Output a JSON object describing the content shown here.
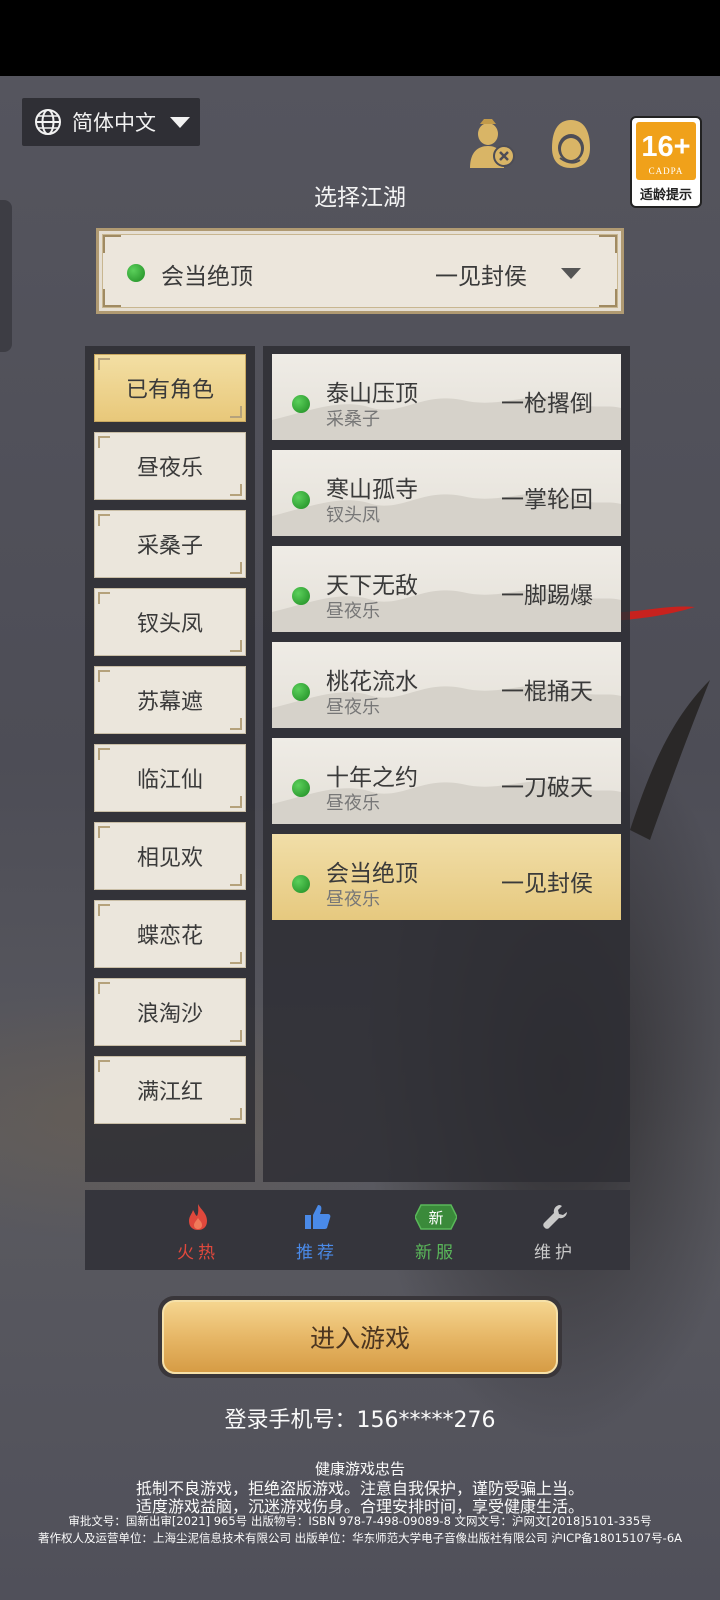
{
  "language": {
    "label": "简体中文"
  },
  "age_rating": {
    "badge": "16+",
    "org": "CADPA",
    "tip": "适龄提示"
  },
  "title": "选择江湖",
  "selected_server": {
    "name": "会当绝顶",
    "role": "一见封侯",
    "status_color": "#2e9e32"
  },
  "categories": [
    {
      "label": "已有角色",
      "active": true
    },
    {
      "label": "昼夜乐"
    },
    {
      "label": "采桑子"
    },
    {
      "label": "钗头凤"
    },
    {
      "label": "苏幕遮"
    },
    {
      "label": "临江仙"
    },
    {
      "label": "相见欢"
    },
    {
      "label": "蝶恋花"
    },
    {
      "label": "浪淘沙"
    },
    {
      "label": "满江红"
    }
  ],
  "servers": [
    {
      "name": "泰山压顶",
      "group": "采桑子",
      "role": "一枪撂倒"
    },
    {
      "name": "寒山孤寺",
      "group": "钗头凤",
      "role": "一掌轮回"
    },
    {
      "name": "天下无敌",
      "group": "昼夜乐",
      "role": "一脚踢爆"
    },
    {
      "name": "桃花流水",
      "group": "昼夜乐",
      "role": "一棍捅天"
    },
    {
      "name": "十年之约",
      "group": "昼夜乐",
      "role": "一刀破天"
    },
    {
      "name": "会当绝顶",
      "group": "昼夜乐",
      "role": "一见封侯",
      "active": true
    }
  ],
  "tabs": [
    {
      "label": "火热",
      "icon": "flame-icon",
      "color": "#e0483c"
    },
    {
      "label": "推荐",
      "icon": "thumbs-up-icon",
      "color": "#4a8ae8"
    },
    {
      "label": "新服",
      "icon": "new-badge-icon",
      "badge": "新",
      "color": "#5ab85a"
    },
    {
      "label": "维护",
      "icon": "wrench-icon",
      "color": "#c9c9c9"
    }
  ],
  "enter_button": "进入游戏",
  "phone_label": "登录手机号：156*****276",
  "notice": {
    "title": "健康游戏忠告",
    "line1": "抵制不良游戏，拒绝盗版游戏。注意自我保护，谨防受骗上当。",
    "line2": "适度游戏益脑，沉迷游戏伤身。合理安排时间，享受健康生活。",
    "line3": "审批文号：国新出审[2021] 965号    出版物号：ISBN 978-7-498-09089-8    文网文号：沪网文[2018]5101-335号",
    "line4": "著作权人及运营单位：上海尘泥信息技术有限公司    出版单位：华东师范大学电子音像出版社有限公司    沪ICP备18015107号-6A"
  }
}
